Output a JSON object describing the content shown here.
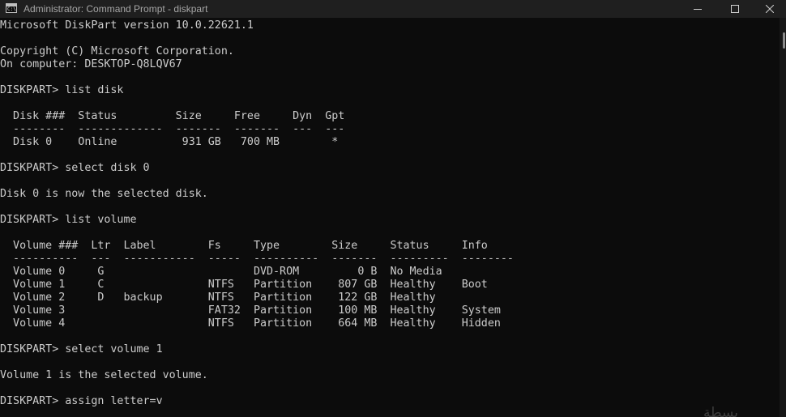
{
  "window": {
    "title": "Administrator: Command Prompt - diskpart",
    "app_icon": "cmd-icon",
    "controls": [
      "minimize-icon",
      "maximize-icon",
      "close-icon"
    ]
  },
  "console": {
    "lines": [
      "Microsoft DiskPart version 10.0.22621.1",
      "",
      "Copyright (C) Microsoft Corporation.",
      "On computer: DESKTOP-Q8LQV67",
      "",
      "DISKPART> list disk",
      "",
      "  Disk ###  Status         Size     Free     Dyn  Gpt",
      "  --------  -------------  -------  -------  ---  ---",
      "  Disk 0    Online          931 GB   700 MB        *",
      "",
      "DISKPART> select disk 0",
      "",
      "Disk 0 is now the selected disk.",
      "",
      "DISKPART> list volume",
      "",
      "  Volume ###  Ltr  Label        Fs     Type        Size     Status     Info",
      "  ----------  ---  -----------  -----  ----------  -------  ---------  --------",
      "  Volume 0     G                       DVD-ROM         0 B  No Media",
      "  Volume 1     C                NTFS   Partition    807 GB  Healthy    Boot",
      "  Volume 2     D   backup       NTFS   Partition    122 GB  Healthy",
      "  Volume 3                      FAT32  Partition    100 MB  Healthy    System",
      "  Volume 4                      NTFS   Partition    664 MB  Healthy    Hidden",
      "",
      "DISKPART> select volume 1",
      "",
      "Volume 1 is the selected volume.",
      "",
      "DISKPART> assign letter=v"
    ]
  },
  "watermark": {
    "text": "بسطة"
  },
  "colors": {
    "background": "#0c0c0c",
    "titlebar": "#1f1f1f",
    "text": "#cccccc",
    "title_text": "#a6a6a6"
  }
}
